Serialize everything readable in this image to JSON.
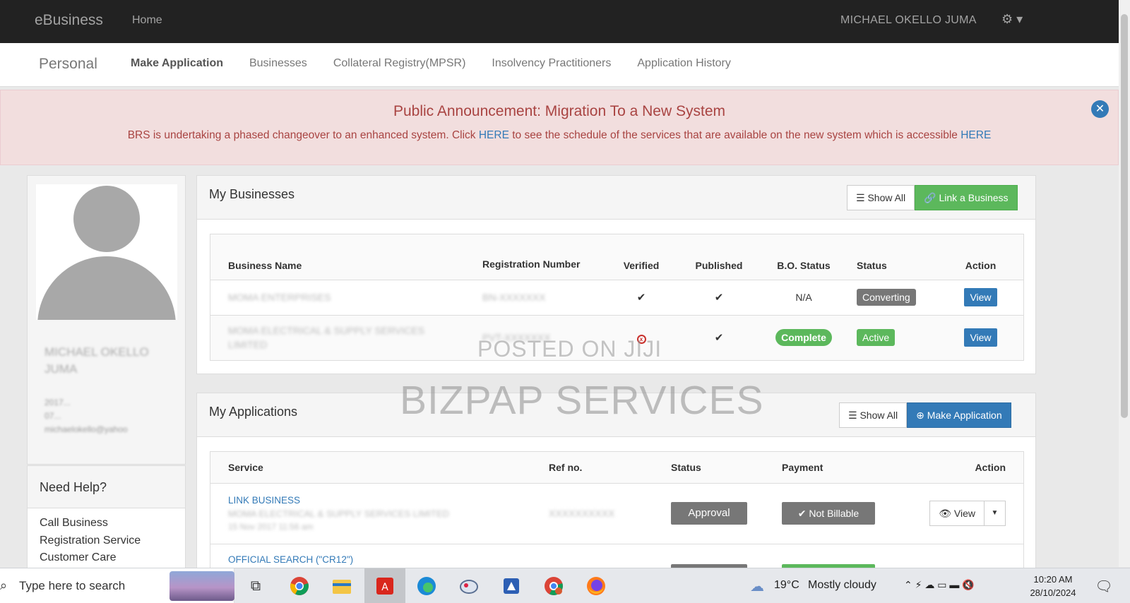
{
  "navbar": {
    "brand": "eBusiness",
    "home": "Home",
    "user": "MICHAEL OKELLO JUMA",
    "gear": "⚙ ▾"
  },
  "subnav": {
    "title": "Personal",
    "links": [
      "Make Application",
      "Businesses",
      "Collateral Registry(MPSR)",
      "Insolvency Practitioners",
      "Application History"
    ]
  },
  "announcement": {
    "heading": "Public Announcement: Migration To a New System",
    "text1": "BRS is undertaking a phased changeover to an enhanced system. Click ",
    "link1": "HERE",
    "text2": " to see the schedule of the services that are available on the new system which is accessible ",
    "link2": "HERE",
    "close": "✕"
  },
  "profile": {
    "name": "MICHAEL OKELLO JUMA",
    "line1": "2017...",
    "line2": "07...",
    "email": "michaelokello@yahoo"
  },
  "help": {
    "title": "Need Help?",
    "body": "Call Business Registration Service Customer Care"
  },
  "businesses": {
    "title": "My Businesses",
    "show_all": "Show All",
    "link_business": "Link a Business",
    "headers": [
      "Business Name",
      "Registration Number",
      "Verified",
      "Published",
      "B.O. Status",
      "Status",
      "Action"
    ],
    "rows": [
      {
        "name": "MOMA ENTERPRISES",
        "reg": "BN-XXXXXXX",
        "verified": "✔",
        "published": "✔",
        "bo": "N/A",
        "status": "Converting",
        "action": "View"
      },
      {
        "name": "MOMA ELECTRICAL & SUPPLY SERVICES LIMITED",
        "reg": "PVT-XXXXXXX",
        "verified": "x",
        "published": "✔",
        "bo": "Complete",
        "status": "Active",
        "action": "View"
      }
    ]
  },
  "applications": {
    "title": "My Applications",
    "show_all": "Show All",
    "make_application": "Make Application",
    "headers": [
      "Service",
      "Ref no.",
      "Status",
      "Payment",
      "Action"
    ],
    "rows": [
      {
        "service": "LINK BUSINESS",
        "detail": "MOMA ELECTRICAL & SUPPLY SERVICES LIMITED",
        "date": "15 Nov 2017 11:56 am",
        "ref": "XXXXXXXXXX",
        "status": "Approval",
        "payment": "Not Billable",
        "action": "View"
      },
      {
        "service": "OFFICIAL SEARCH (\"CR12\")"
      }
    ]
  },
  "watermarks": {
    "small": "POSTED ON JIJI",
    "large": "BIZPAP SERVICES"
  },
  "taskbar": {
    "search": "Type here to search",
    "weather_temp": "19°C",
    "weather_text": "Mostly cloudy",
    "time": "10:20 AM",
    "date": "28/10/2024"
  }
}
